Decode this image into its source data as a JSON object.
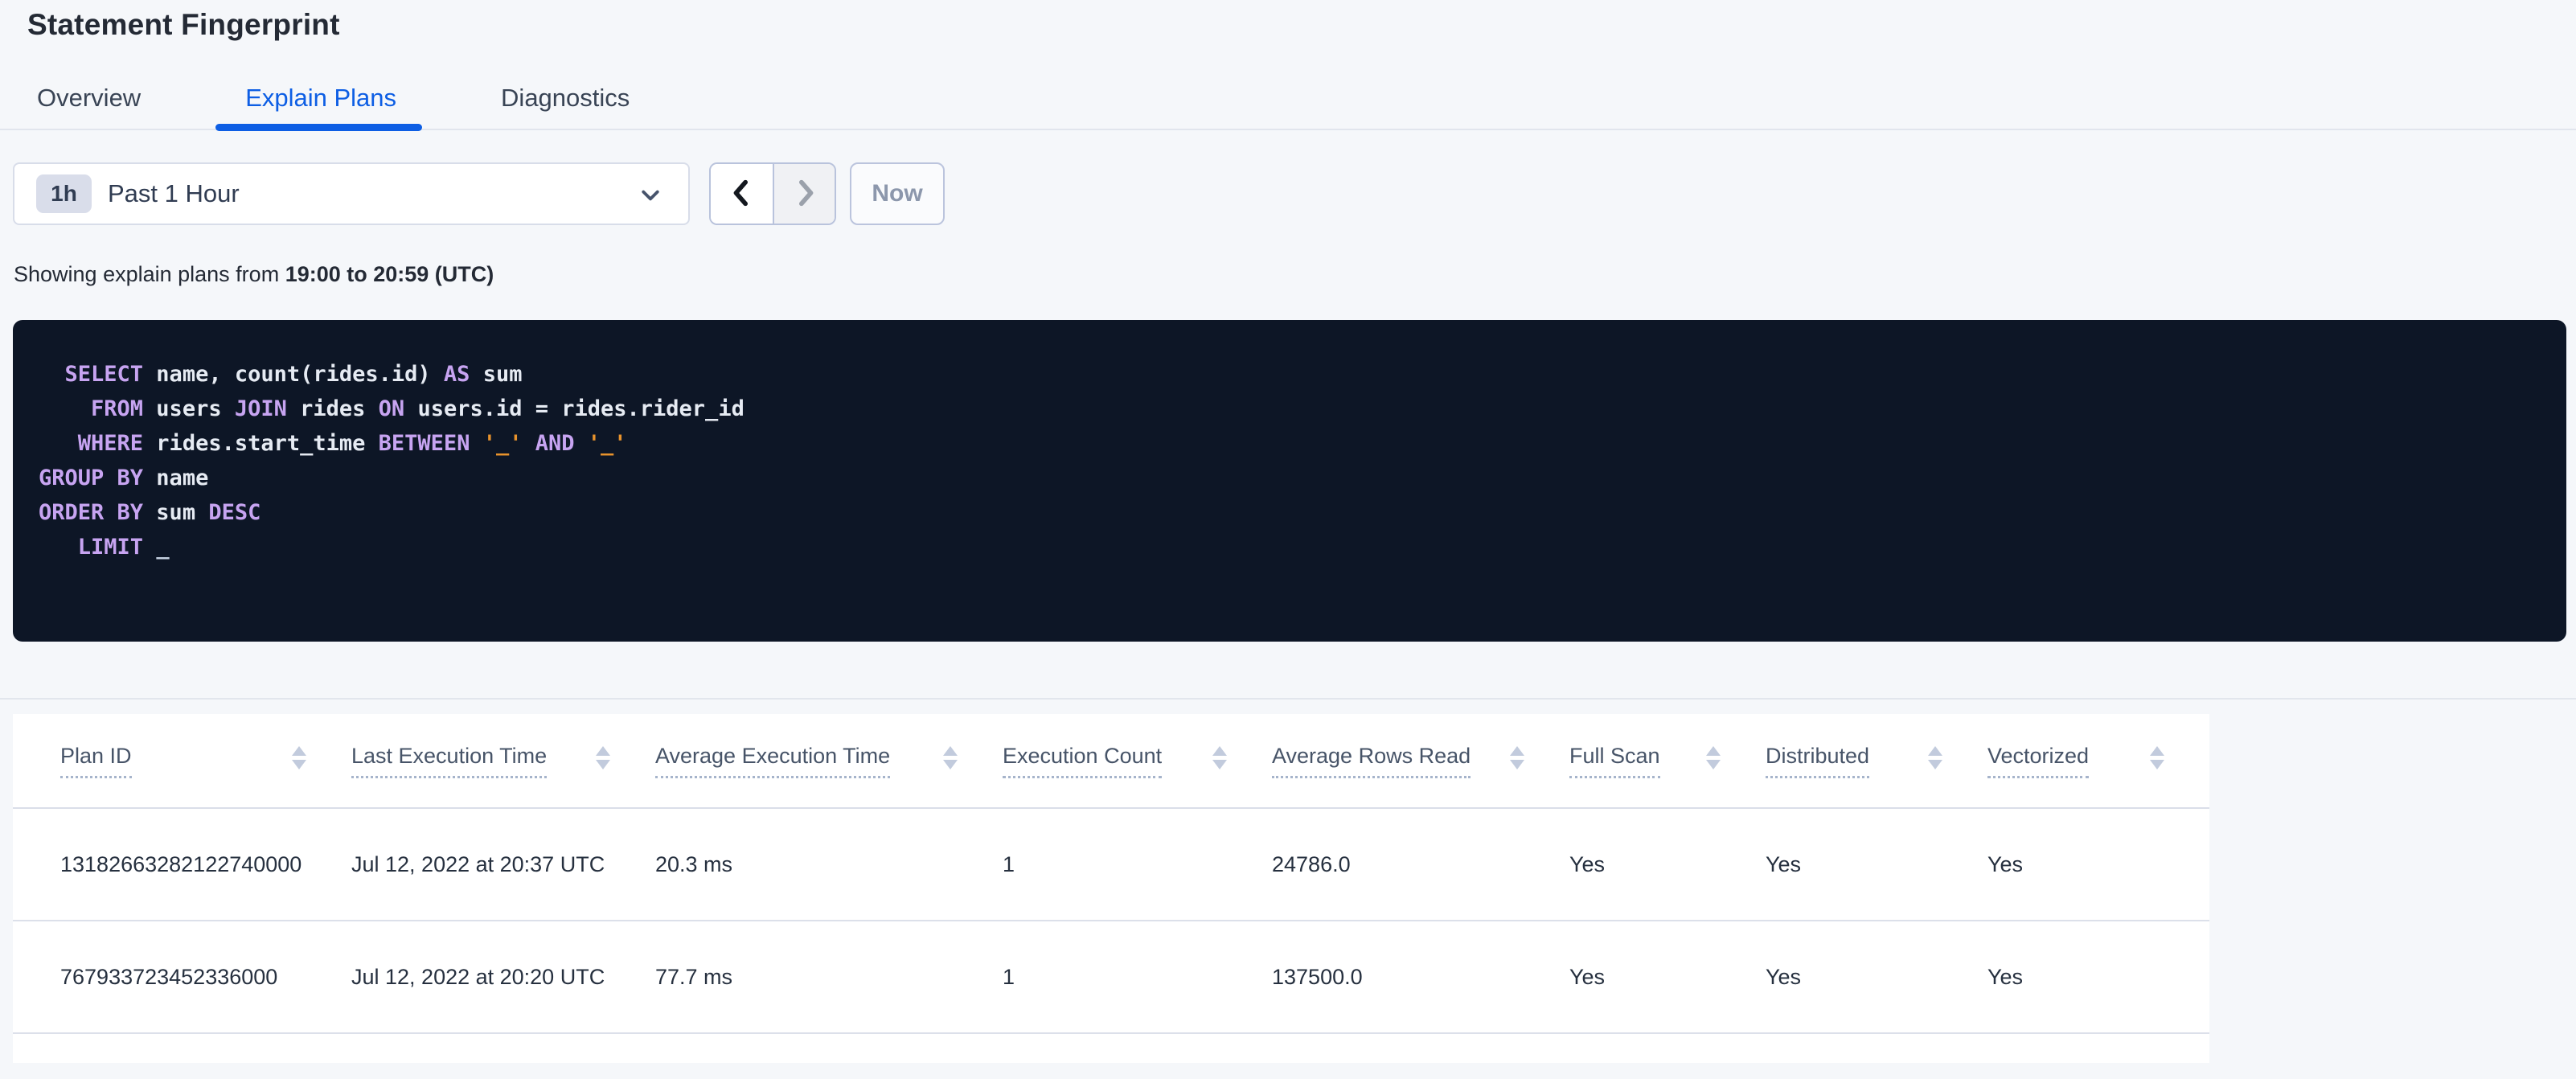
{
  "page": {
    "title": "Statement Fingerprint"
  },
  "tabs": [
    {
      "label": "Overview",
      "active": false
    },
    {
      "label": "Explain Plans",
      "active": true
    },
    {
      "label": "Diagnostics",
      "active": false
    }
  ],
  "time_selector": {
    "range_badge": "1h",
    "range_label": "Past 1 Hour",
    "now_label": "Now",
    "icons": [
      "chevron-down-icon",
      "chevron-left-icon",
      "chevron-right-icon"
    ]
  },
  "summary": {
    "prefix": "Showing explain plans from ",
    "range": "19:00 to 20:59 (UTC)"
  },
  "sql": {
    "lines": [
      [
        {
          "c": "kw",
          "v": "  SELECT"
        },
        {
          "c": "id",
          "v": " name, count(rides.id) "
        },
        {
          "c": "kw",
          "v": "AS"
        },
        {
          "c": "id",
          "v": " sum"
        }
      ],
      [
        {
          "c": "kw",
          "v": "    FROM"
        },
        {
          "c": "id",
          "v": " users "
        },
        {
          "c": "kw",
          "v": "JOIN"
        },
        {
          "c": "id",
          "v": " rides "
        },
        {
          "c": "kw",
          "v": "ON"
        },
        {
          "c": "id",
          "v": " users.id = rides.rider_id"
        }
      ],
      [
        {
          "c": "kw",
          "v": "   WHERE"
        },
        {
          "c": "id",
          "v": " rides.start_time "
        },
        {
          "c": "kw",
          "v": "BETWEEN "
        },
        {
          "c": "str",
          "v": "'_'"
        },
        {
          "c": "kw",
          "v": " AND "
        },
        {
          "c": "str",
          "v": "'_'"
        }
      ],
      [
        {
          "c": "kw",
          "v": "GROUP BY"
        },
        {
          "c": "id",
          "v": " name"
        }
      ],
      [
        {
          "c": "kw",
          "v": "ORDER BY"
        },
        {
          "c": "id",
          "v": " sum "
        },
        {
          "c": "kw",
          "v": "DESC"
        }
      ],
      [
        {
          "c": "kw",
          "v": "   LIMIT "
        },
        {
          "c": "ph",
          "v": "_"
        }
      ]
    ]
  },
  "table": {
    "columns": [
      {
        "label": "Plan ID"
      },
      {
        "label": "Last Execution Time"
      },
      {
        "label": "Average Execution Time"
      },
      {
        "label": "Execution Count"
      },
      {
        "label": "Average Rows Read"
      },
      {
        "label": "Full Scan"
      },
      {
        "label": "Distributed"
      },
      {
        "label": "Vectorized"
      }
    ],
    "rows": [
      [
        "13182663282122740000",
        "Jul 12, 2022 at 20:37 UTC",
        "20.3 ms",
        "1",
        "24786.0",
        "Yes",
        "Yes",
        "Yes"
      ],
      [
        "767933723452336000",
        "Jul 12, 2022 at 20:20 UTC",
        "77.7 ms",
        "1",
        "137500.0",
        "Yes",
        "Yes",
        "Yes"
      ]
    ]
  },
  "colors": {
    "accent_blue": "#0D5EE4",
    "page_background": "#F5F7FA",
    "sql_background": "#0D1626",
    "sql_keyword": "#C7A4F1",
    "sql_identifier": "#E6EBF3",
    "sql_string": "#E8932C",
    "badge_background": "#D9DDEA"
  }
}
